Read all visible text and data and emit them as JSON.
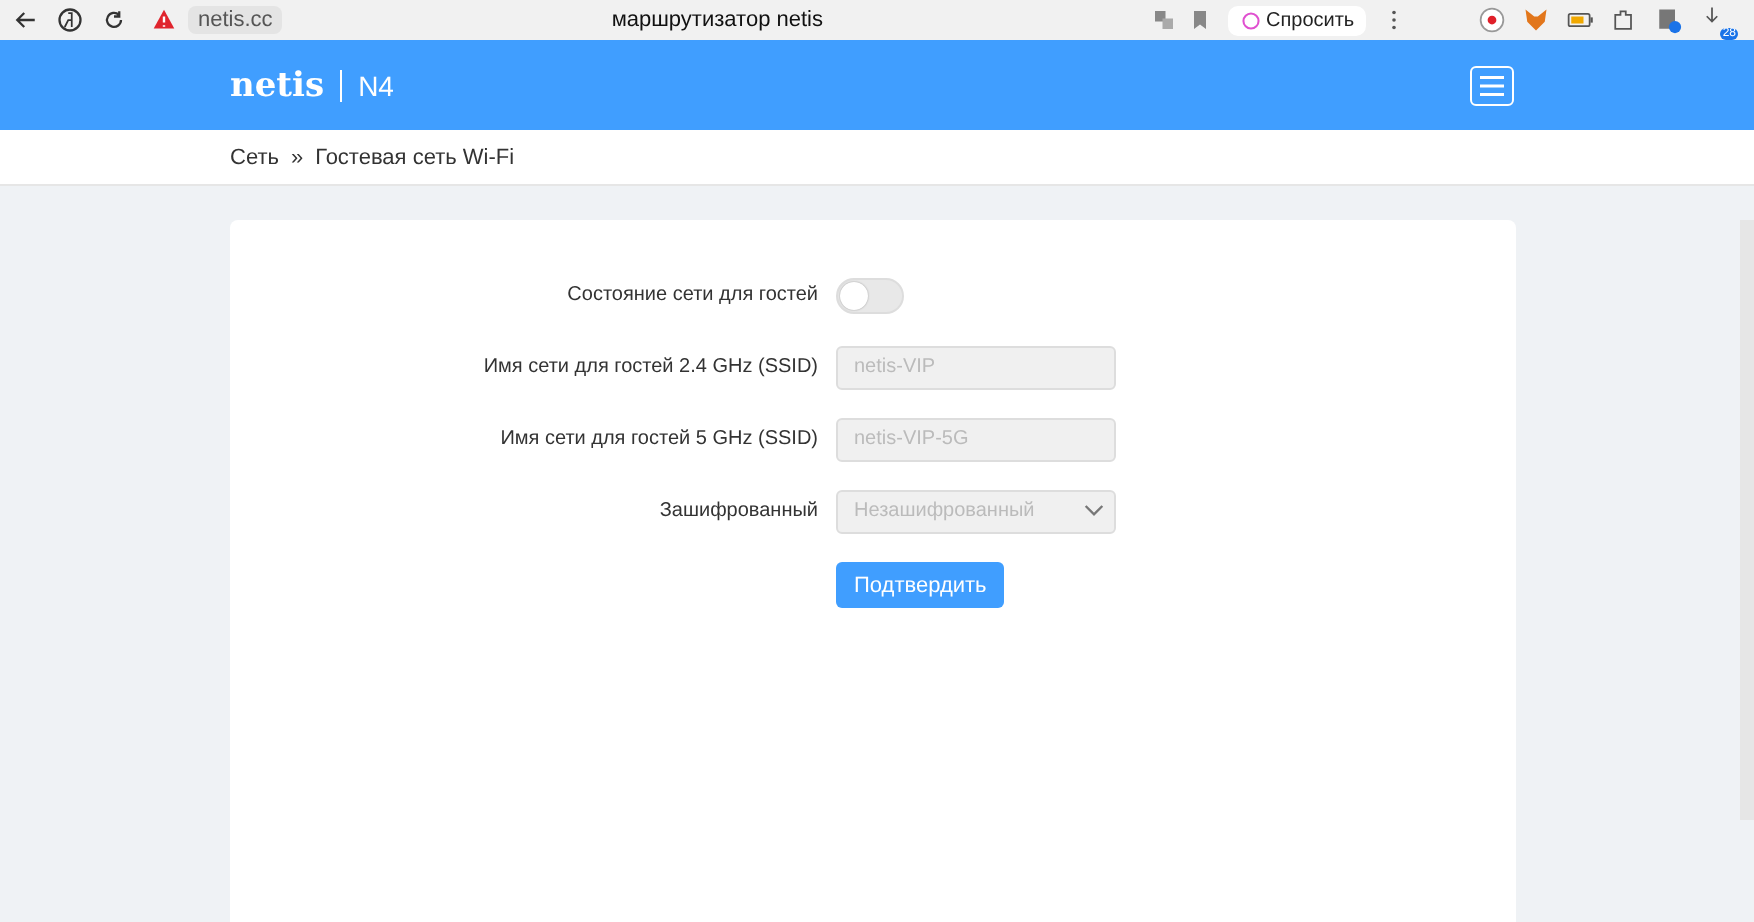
{
  "browser": {
    "url": "netis.cc",
    "title": "маршрутизатор netis",
    "ask_button": "Спросить",
    "download_badge": "28"
  },
  "header": {
    "logo": "netis",
    "model": "N4"
  },
  "breadcrumb": [
    "Сеть",
    "»",
    "Гостевая сеть Wi-Fi"
  ],
  "form": {
    "rows": [
      {
        "kind": "toggle",
        "label": "Состояние сети для гостей",
        "on": false
      },
      {
        "kind": "text",
        "label": "Имя сети для гостей 2.4 GHz (SSID)",
        "value": "netis-VIP",
        "disabled": true
      },
      {
        "kind": "text",
        "label": "Имя сети для гостей 5 GHz (SSID)",
        "value": "netis-VIP-5G",
        "disabled": true
      },
      {
        "kind": "select",
        "label": "Зашифрованный",
        "value": "Незашифрованный",
        "disabled": true
      }
    ],
    "submit": "Подтвердить"
  }
}
